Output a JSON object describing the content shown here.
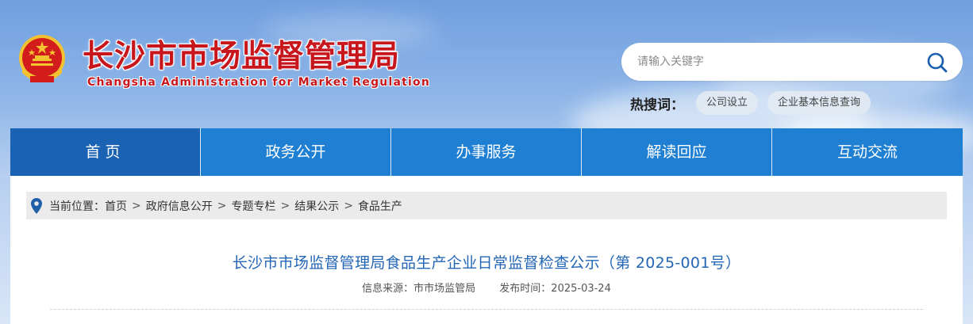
{
  "header": {
    "title": "长沙市市场监督管理局",
    "subtitle": "Changsha Administration for Market Regulation",
    "emblem_icon": "national-emblem-icon"
  },
  "search": {
    "placeholder": "请输入关键字",
    "button_icon": "search-icon"
  },
  "hot_search": {
    "label": "热搜词：",
    "tags": [
      "公司设立",
      "企业基本信息查询"
    ]
  },
  "nav": {
    "items": [
      "首页",
      "政务公开",
      "办事服务",
      "解读回应",
      "互动交流"
    ],
    "active_index": 0
  },
  "breadcrumb": {
    "prefix": "当前位置：",
    "items": [
      "首页",
      "政府信息公开",
      "专题专栏",
      "结果公示",
      "食品生产"
    ],
    "separator": ">"
  },
  "article": {
    "title": "长沙市市场监督管理局食品生产企业日常监督检查公示（第 2025-001号）",
    "source": "信息来源：市市场监管局",
    "publish_time": "发布时间：2025-03-24"
  },
  "colors": {
    "brand_red": "#c8161d",
    "nav_blue": "#1f80d3",
    "nav_active": "#1a63b4",
    "title_blue": "#2366b5"
  }
}
